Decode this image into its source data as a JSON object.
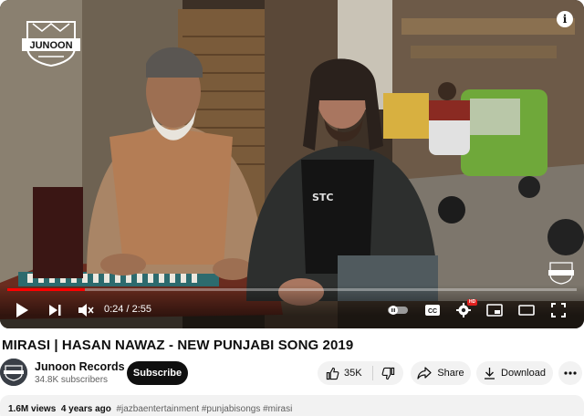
{
  "player": {
    "current_time": "0:24",
    "duration": "2:55",
    "time_separator": " / ",
    "progress_fraction": 0.137,
    "watermark_text": "JUNOON",
    "hd_badge": "HD",
    "info_icon": "i"
  },
  "video": {
    "title": "MIRASI | HASAN NAWAZ - NEW PUNJABI SONG 2019"
  },
  "channel": {
    "name": "Junoon Records",
    "subscribers": "34.8K subscribers",
    "subscribe_label": "Subscribe"
  },
  "actions": {
    "likes": "35K",
    "share_label": "Share",
    "download_label": "Download"
  },
  "description": {
    "views": "1.6M views",
    "age": "4 years ago",
    "hashtags": "#jazbaentertainment #punjabisongs #mirasi"
  },
  "colors": {
    "progress": "#ff0000",
    "subscribe_bg": "#0f0f0f",
    "pill_bg": "#f2f2f2"
  },
  "icons": [
    "play-icon",
    "next-icon",
    "mute-icon",
    "autoplay-toggle-icon",
    "captions-icon",
    "settings-icon",
    "miniplayer-icon",
    "theater-icon",
    "fullscreen-icon",
    "thumbs-up-icon",
    "thumbs-down-icon",
    "share-icon",
    "download-icon",
    "more-icon",
    "info-icon"
  ]
}
